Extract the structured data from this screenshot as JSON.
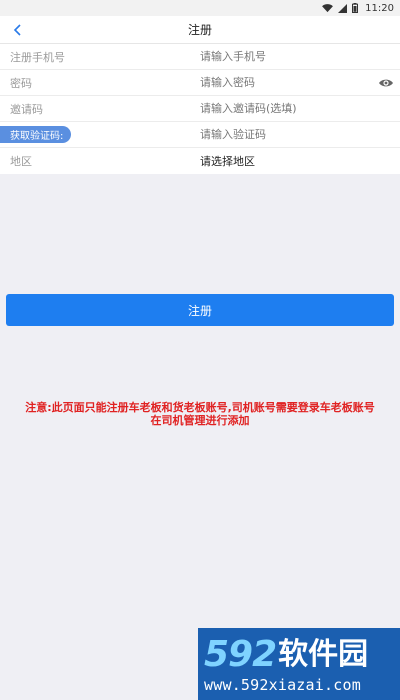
{
  "status": {
    "time": "11:20"
  },
  "nav": {
    "title": "注册"
  },
  "form": {
    "phone": {
      "label": "注册手机号",
      "placeholder": "请输入手机号"
    },
    "password": {
      "label": "密码",
      "placeholder": "请输入密码"
    },
    "invite": {
      "label": "邀请码",
      "placeholder": "请输入邀请码(选填)"
    },
    "code": {
      "button_label": "获取验证码:",
      "placeholder": "请输入验证码"
    },
    "region": {
      "label": "地区",
      "value": "请选择地区"
    }
  },
  "register_button": {
    "label": "注册"
  },
  "notice": {
    "line1": "注意:此页面只能注册车老板和货老板账号,司机账号需要登录车老板账号",
    "line2": "在司机管理进行添加"
  },
  "watermark": {
    "digits": "592",
    "name": "软件园",
    "url": "www.592xiazai.com"
  },
  "colors": {
    "primary": "#1e7ef0",
    "code_button": "#5a8fe0",
    "notice": "#e02222",
    "background": "#efeff4"
  }
}
